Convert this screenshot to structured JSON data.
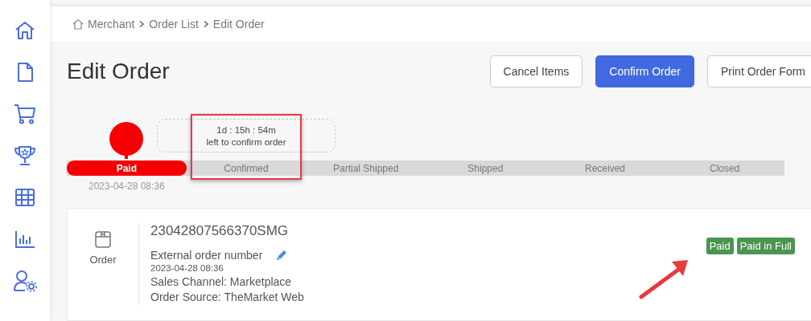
{
  "sidebar": {
    "items": [
      {
        "kind": "home",
        "selected": false
      },
      {
        "kind": "document",
        "selected": false
      },
      {
        "kind": "cart",
        "selected": false
      },
      {
        "kind": "trophy",
        "selected": false
      },
      {
        "kind": "grid",
        "selected": false
      },
      {
        "kind": "chart",
        "selected": false
      },
      {
        "kind": "users",
        "selected": false
      }
    ]
  },
  "breadcrumb": [
    "Merchant",
    "Order List",
    "Edit Order"
  ],
  "page_title": "Edit Order",
  "buttons": [
    {
      "label": "Cancel Items",
      "kind": "secondary"
    },
    {
      "label": "Confirm Order",
      "kind": "primary"
    },
    {
      "label": "Print Order Form",
      "kind": "secondary"
    }
  ],
  "progress": {
    "steps": [
      {
        "label": "Paid",
        "done": true,
        "date": "2023-04-28 08:36"
      },
      {
        "label": "Confirmed",
        "done": false,
        "countdown": {
          "time": "1d : 15h : 54m",
          "label": "left to confirm order"
        }
      },
      {
        "label": "Partial Shipped",
        "done": false
      },
      {
        "label": "Shipped",
        "done": false
      },
      {
        "label": "Received",
        "done": false
      },
      {
        "label": "Closed",
        "done": false
      }
    ]
  },
  "order": {
    "type_label": "Order",
    "number": "23042807566370SMG",
    "external_label": "External order number",
    "date": "2023-04-28 08:36",
    "sales_channel": "Sales Channel: Marketplace",
    "order_source": "Order Source: TheMarket Web",
    "badges": [
      "Paid",
      "Paid in Full"
    ]
  }
}
